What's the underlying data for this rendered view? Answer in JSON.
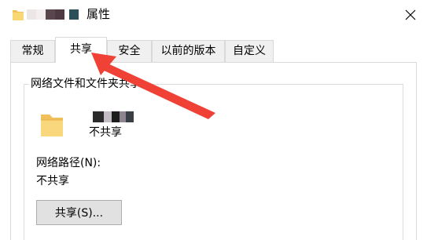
{
  "window": {
    "title": "属性",
    "close_icon": "close-icon",
    "folder_icon": "folder-icon",
    "redacted_name_colors": [
      "#ece6e6",
      "#f4eeee",
      "#5a474e",
      "#4e3a43",
      "#2a4f58"
    ]
  },
  "tabs": [
    {
      "label": "常规",
      "active": false
    },
    {
      "label": "共享",
      "active": true
    },
    {
      "label": "安全",
      "active": false
    },
    {
      "label": "以前的版本",
      "active": false
    },
    {
      "label": "自定义",
      "active": false
    }
  ],
  "sharing": {
    "group_title": "网络文件和文件夹共享",
    "folder_icon": "folder-icon",
    "share_status": "不共享",
    "network_path_label": "网络路径(N):",
    "network_path_value": "不共享",
    "share_button_label": "共享(S)...",
    "redacted_name_colors": [
      "#2b2b2b",
      "#c4bcc4",
      "#1d1d1d",
      "#8e8490",
      "#3a3f45"
    ]
  },
  "annotation": {
    "arrow_color": "#ef4136"
  }
}
